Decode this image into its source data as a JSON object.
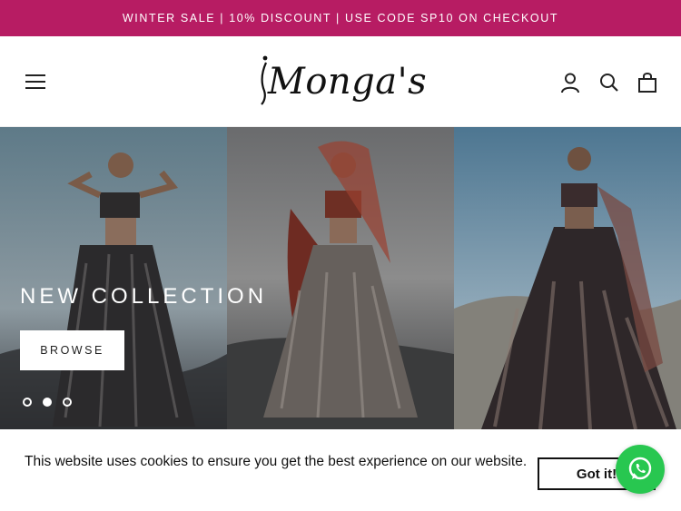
{
  "colors": {
    "announce_bg": "#b71c63",
    "whatsapp_green": "#28c750"
  },
  "announcement": {
    "text": "WINTER SALE | 10% DISCOUNT | USE CODE SP10 ON CHECKOUT"
  },
  "header": {
    "logo_text": "Monga's",
    "icons": [
      "hamburger-menu-icon",
      "account-icon",
      "search-icon",
      "cart-bag-icon"
    ]
  },
  "hero": {
    "title": "NEW COLLECTION",
    "button_label": "BROWSE",
    "slides_total": 3,
    "active_slide": 2
  },
  "cookie_banner": {
    "message": "This website uses cookies to ensure you get the best experience on our website.",
    "button_label": "Got it!"
  }
}
